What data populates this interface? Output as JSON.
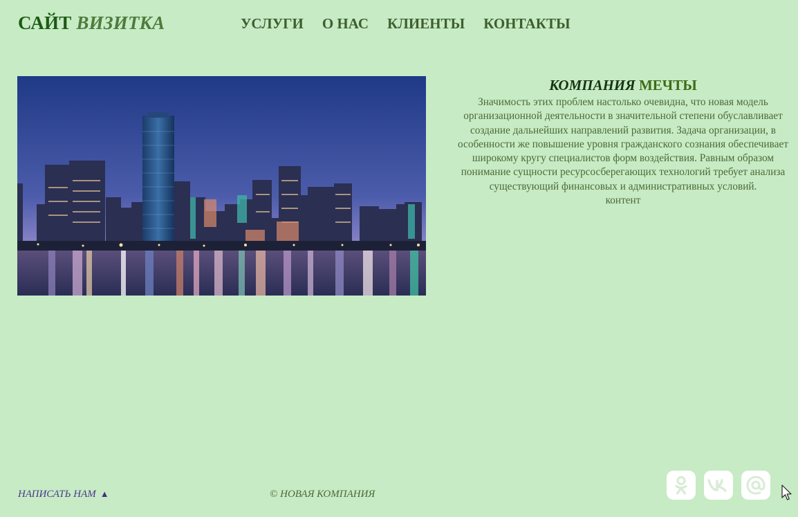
{
  "header": {
    "logo_main": "САЙТ",
    "logo_accent": "ВИЗИТКА",
    "nav": [
      "УСЛУГИ",
      "О НАС",
      "КЛИЕНТЫ",
      "КОНТАКТЫ"
    ]
  },
  "hero": {
    "icon": "city-skyline-photo"
  },
  "about": {
    "title_em": "КОМПАНИЯ",
    "title_rest": "МЕЧТЫ",
    "paragraph": "Значимость этих проблем настолько очевидна, что новая модель организационной деятельности в значительной степени обуславливает создание дальнейших направлений развития. Задача организации, в особенности же повышение уровня гражданского сознания обеспечивает широкому кругу специалистов форм воздействия. Равным образом понимание сущности ресурсосберегающих технологий требует анализа существующий финансовых и административных условий.",
    "extra": "контент"
  },
  "footer": {
    "write_us": "НАПИСАТЬ НАМ",
    "write_icon": "triangle-up-icon",
    "copyright": "© НОВАЯ КОМПАНИЯ",
    "social": [
      "odnoklassniki-icon",
      "vk-icon",
      "email-at-icon"
    ]
  },
  "colors": {
    "background": "#c7ebc5",
    "logo": "#1d5a14",
    "nav": "#3f5e2f",
    "text": "#4d6a36",
    "link": "#4a3a8a",
    "social_button": "#ffffff",
    "social_icon": "#d9ecd6"
  }
}
